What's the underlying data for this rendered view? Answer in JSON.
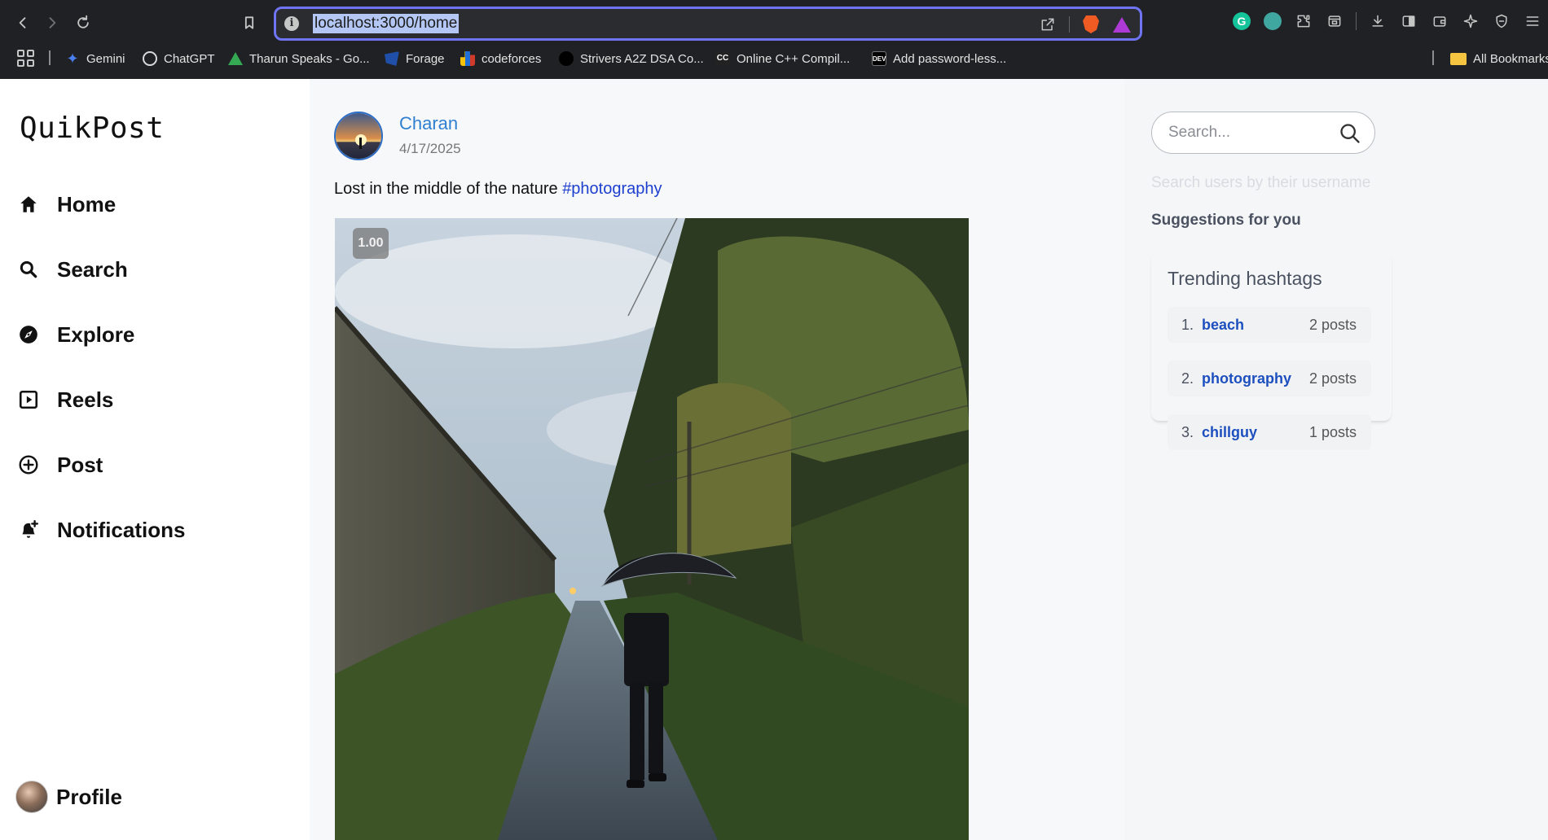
{
  "browser": {
    "url": "localhost:3000/home",
    "bookmarks": [
      {
        "label": "Gemini",
        "color": "#4a7ff0"
      },
      {
        "label": "ChatGPT",
        "color": "#d9d9d9"
      },
      {
        "label": "Tharun Speaks - Go...",
        "color": "#34a853"
      },
      {
        "label": "Forage",
        "color": "#3b6fd8"
      },
      {
        "label": "codeforces",
        "color": "#f4c20d"
      },
      {
        "label": "Strivers A2Z DSA Co...",
        "color": "#222222"
      },
      {
        "label": "Online C++ Compil...",
        "color": "#333333"
      },
      {
        "label": "Add password-less...",
        "color": "#111111"
      }
    ],
    "all_bookmarks": "All Bookmarks"
  },
  "app": {
    "logo": "QuikPost",
    "nav": [
      {
        "label": "Home",
        "icon": "home-icon"
      },
      {
        "label": "Search",
        "icon": "search-icon"
      },
      {
        "label": "Explore",
        "icon": "compass-icon"
      },
      {
        "label": "Reels",
        "icon": "reels-icon"
      },
      {
        "label": "Post",
        "icon": "plus-circle-icon"
      },
      {
        "label": "Notifications",
        "icon": "bell-icon"
      }
    ],
    "profile_label": "Profile"
  },
  "post": {
    "author": "Charan",
    "date": "4/17/2025",
    "caption_text": "Lost in the middle of the nature ",
    "caption_tag": "#photography",
    "speed": "1.00"
  },
  "right": {
    "search_placeholder": "Search...",
    "search_hint": "Search users by their username",
    "suggestions_title": "Suggestions for you",
    "trending_title": "Trending hashtags",
    "hashtags": [
      {
        "num": "1.",
        "tag": "beach",
        "count": "2 posts"
      },
      {
        "num": "2.",
        "tag": "photography",
        "count": "2 posts"
      },
      {
        "num": "3.",
        "tag": "chillguy",
        "count": "1 posts"
      }
    ]
  }
}
